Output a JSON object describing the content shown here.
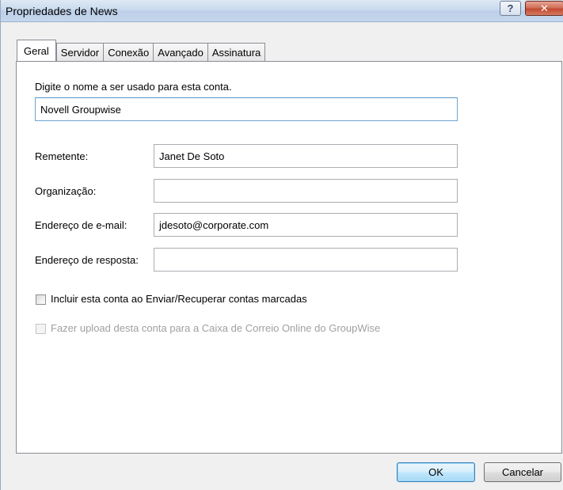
{
  "window": {
    "title": "Propriedades de News",
    "help_label": "?",
    "close_label": "✕"
  },
  "tabs": [
    {
      "label": "Geral",
      "active": true
    },
    {
      "label": "Servidor",
      "active": false
    },
    {
      "label": "Conexão",
      "active": false
    },
    {
      "label": "Avançado",
      "active": false
    },
    {
      "label": "Assinatura",
      "active": false
    }
  ],
  "account": {
    "prompt": "Digite o nome a ser usado para esta conta.",
    "name_value": "Novell Groupwise"
  },
  "fields": {
    "sender_label": "Remetente:",
    "sender_value": "Janet De Soto",
    "org_label": "Organização:",
    "org_value": "",
    "email_label": "Endereço de e-mail:",
    "email_value": "jdesoto@corporate.com",
    "reply_label": "Endereço de resposta:",
    "reply_value": ""
  },
  "options": {
    "include_label": "Incluir esta conta ao Enviar/Recuperar contas marcadas",
    "include_checked": false,
    "upload_label": "Fazer upload desta conta para a Caixa de Correio Online do GroupWise",
    "upload_checked": false,
    "upload_enabled": false
  },
  "buttons": {
    "ok_label": "OK",
    "cancel_label": "Cancelar"
  }
}
